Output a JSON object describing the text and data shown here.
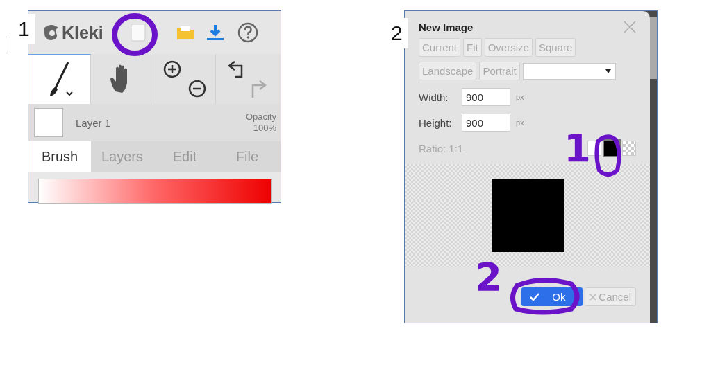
{
  "panel_1": {
    "step_label": "1",
    "app_name": "Kleki",
    "layer": {
      "name": "Layer 1",
      "opacity_label": "Opacity",
      "opacity_value": "100%"
    },
    "tabs": [
      {
        "label": "Brush",
        "selected": true
      },
      {
        "label": "Layers",
        "selected": false
      },
      {
        "label": "Edit",
        "selected": false
      },
      {
        "label": "File",
        "selected": false
      }
    ]
  },
  "panel_2": {
    "step_label": "2",
    "dialog": {
      "title": "New Image",
      "presets": [
        {
          "label": "Current"
        },
        {
          "label": "Fit"
        },
        {
          "label": "Oversize"
        },
        {
          "label": "Square"
        },
        {
          "label": "Landscape"
        },
        {
          "label": "Portrait"
        }
      ],
      "width": {
        "label": "Width:",
        "value": "900",
        "unit": "px"
      },
      "height": {
        "label": "Height:",
        "value": "900",
        "unit": "px"
      },
      "ratio": "Ratio: 1:1",
      "backgrounds": [
        {
          "kind": "solid",
          "color": "#ffffff",
          "selected": false
        },
        {
          "kind": "solid",
          "color": "#000000",
          "selected": true
        },
        {
          "kind": "transparent",
          "selected": false
        }
      ],
      "ok": "Ok",
      "cancel": "Cancel"
    }
  },
  "annotations": [
    {
      "text": "1"
    },
    {
      "text": "2"
    }
  ]
}
